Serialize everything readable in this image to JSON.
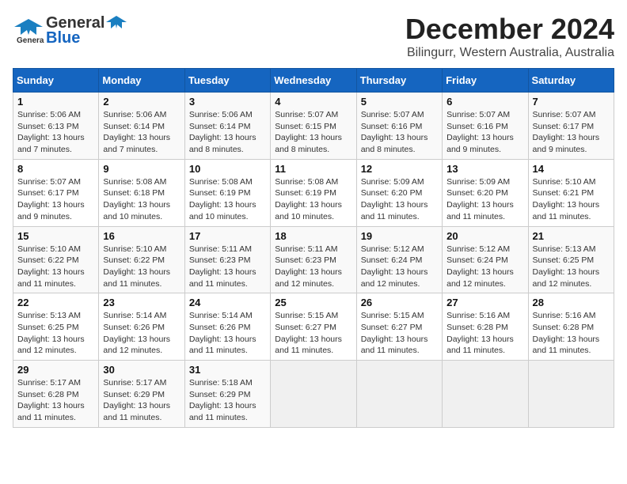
{
  "header": {
    "logo_line1": "General",
    "logo_line2": "Blue",
    "title": "December 2024",
    "subtitle": "Bilingurr, Western Australia, Australia"
  },
  "calendar": {
    "days_of_week": [
      "Sunday",
      "Monday",
      "Tuesday",
      "Wednesday",
      "Thursday",
      "Friday",
      "Saturday"
    ],
    "weeks": [
      [
        {
          "day": null
        },
        {
          "day": null
        },
        {
          "day": null
        },
        {
          "day": null
        },
        {
          "day": null
        },
        {
          "day": null
        },
        {
          "day": "7",
          "sunrise": "5:07 AM",
          "sunset": "6:17 PM",
          "daylight": "13 hours and 9 minutes."
        }
      ],
      [
        {
          "day": "1",
          "sunrise": "5:06 AM",
          "sunset": "6:13 PM",
          "daylight": "13 hours and 7 minutes."
        },
        {
          "day": "2",
          "sunrise": "5:06 AM",
          "sunset": "6:14 PM",
          "daylight": "13 hours and 7 minutes."
        },
        {
          "day": "3",
          "sunrise": "5:06 AM",
          "sunset": "6:14 PM",
          "daylight": "13 hours and 8 minutes."
        },
        {
          "day": "4",
          "sunrise": "5:07 AM",
          "sunset": "6:15 PM",
          "daylight": "13 hours and 8 minutes."
        },
        {
          "day": "5",
          "sunrise": "5:07 AM",
          "sunset": "6:16 PM",
          "daylight": "13 hours and 8 minutes."
        },
        {
          "day": "6",
          "sunrise": "5:07 AM",
          "sunset": "6:16 PM",
          "daylight": "13 hours and 9 minutes."
        },
        {
          "day": "7",
          "sunrise": "5:07 AM",
          "sunset": "6:17 PM",
          "daylight": "13 hours and 9 minutes."
        }
      ],
      [
        {
          "day": "8",
          "sunrise": "5:07 AM",
          "sunset": "6:17 PM",
          "daylight": "13 hours and 9 minutes."
        },
        {
          "day": "9",
          "sunrise": "5:08 AM",
          "sunset": "6:18 PM",
          "daylight": "13 hours and 10 minutes."
        },
        {
          "day": "10",
          "sunrise": "5:08 AM",
          "sunset": "6:19 PM",
          "daylight": "13 hours and 10 minutes."
        },
        {
          "day": "11",
          "sunrise": "5:08 AM",
          "sunset": "6:19 PM",
          "daylight": "13 hours and 10 minutes."
        },
        {
          "day": "12",
          "sunrise": "5:09 AM",
          "sunset": "6:20 PM",
          "daylight": "13 hours and 11 minutes."
        },
        {
          "day": "13",
          "sunrise": "5:09 AM",
          "sunset": "6:20 PM",
          "daylight": "13 hours and 11 minutes."
        },
        {
          "day": "14",
          "sunrise": "5:10 AM",
          "sunset": "6:21 PM",
          "daylight": "13 hours and 11 minutes."
        }
      ],
      [
        {
          "day": "15",
          "sunrise": "5:10 AM",
          "sunset": "6:22 PM",
          "daylight": "13 hours and 11 minutes."
        },
        {
          "day": "16",
          "sunrise": "5:10 AM",
          "sunset": "6:22 PM",
          "daylight": "13 hours and 11 minutes."
        },
        {
          "day": "17",
          "sunrise": "5:11 AM",
          "sunset": "6:23 PM",
          "daylight": "13 hours and 11 minutes."
        },
        {
          "day": "18",
          "sunrise": "5:11 AM",
          "sunset": "6:23 PM",
          "daylight": "13 hours and 12 minutes."
        },
        {
          "day": "19",
          "sunrise": "5:12 AM",
          "sunset": "6:24 PM",
          "daylight": "13 hours and 12 minutes."
        },
        {
          "day": "20",
          "sunrise": "5:12 AM",
          "sunset": "6:24 PM",
          "daylight": "13 hours and 12 minutes."
        },
        {
          "day": "21",
          "sunrise": "5:13 AM",
          "sunset": "6:25 PM",
          "daylight": "13 hours and 12 minutes."
        }
      ],
      [
        {
          "day": "22",
          "sunrise": "5:13 AM",
          "sunset": "6:25 PM",
          "daylight": "13 hours and 12 minutes."
        },
        {
          "day": "23",
          "sunrise": "5:14 AM",
          "sunset": "6:26 PM",
          "daylight": "13 hours and 12 minutes."
        },
        {
          "day": "24",
          "sunrise": "5:14 AM",
          "sunset": "6:26 PM",
          "daylight": "13 hours and 11 minutes."
        },
        {
          "day": "25",
          "sunrise": "5:15 AM",
          "sunset": "6:27 PM",
          "daylight": "13 hours and 11 minutes."
        },
        {
          "day": "26",
          "sunrise": "5:15 AM",
          "sunset": "6:27 PM",
          "daylight": "13 hours and 11 minutes."
        },
        {
          "day": "27",
          "sunrise": "5:16 AM",
          "sunset": "6:28 PM",
          "daylight": "13 hours and 11 minutes."
        },
        {
          "day": "28",
          "sunrise": "5:16 AM",
          "sunset": "6:28 PM",
          "daylight": "13 hours and 11 minutes."
        }
      ],
      [
        {
          "day": "29",
          "sunrise": "5:17 AM",
          "sunset": "6:28 PM",
          "daylight": "13 hours and 11 minutes."
        },
        {
          "day": "30",
          "sunrise": "5:17 AM",
          "sunset": "6:29 PM",
          "daylight": "13 hours and 11 minutes."
        },
        {
          "day": "31",
          "sunrise": "5:18 AM",
          "sunset": "6:29 PM",
          "daylight": "13 hours and 11 minutes."
        },
        {
          "day": null
        },
        {
          "day": null
        },
        {
          "day": null
        },
        {
          "day": null
        }
      ]
    ]
  }
}
